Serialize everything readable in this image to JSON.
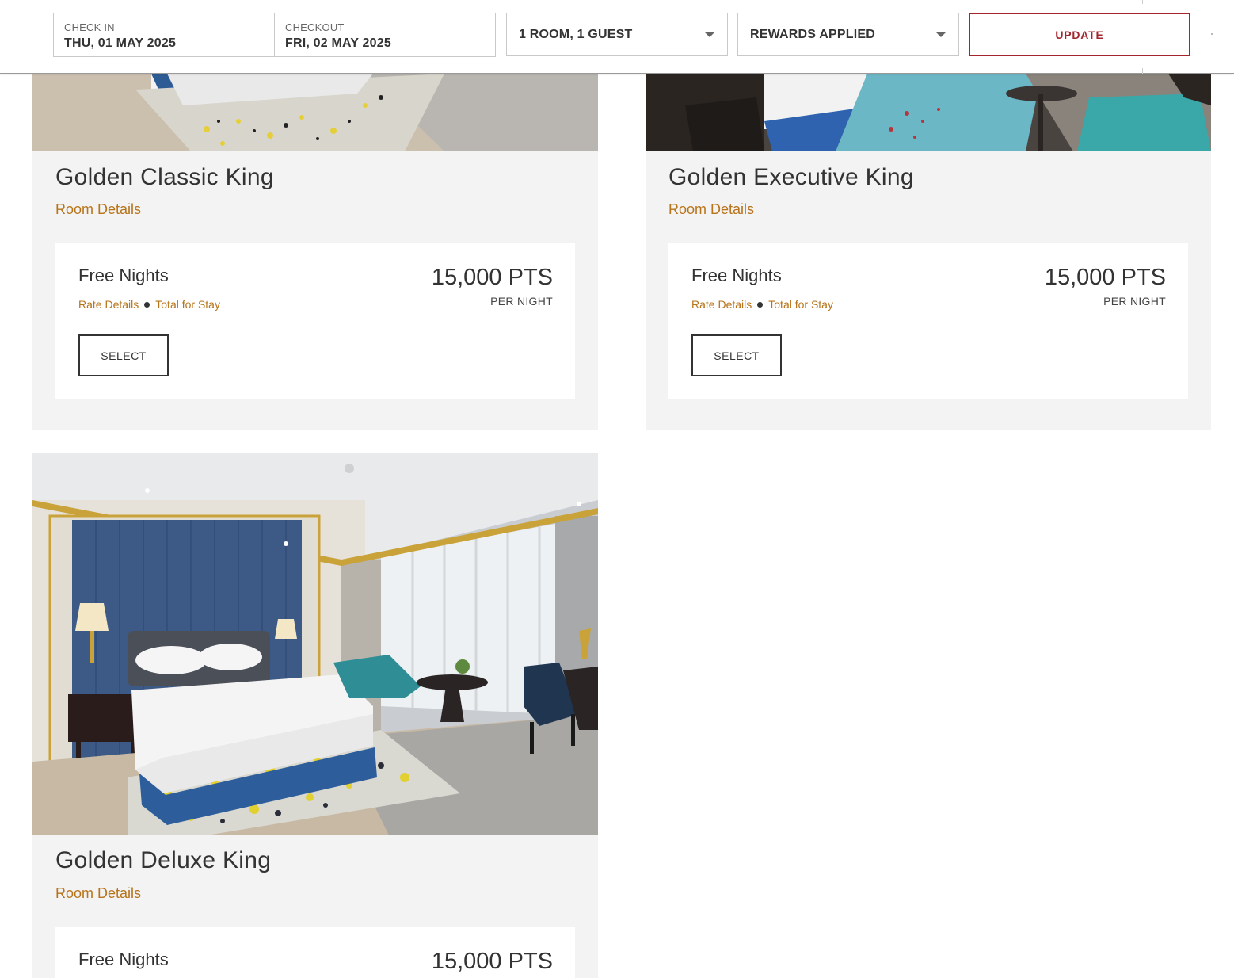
{
  "search": {
    "check_in_label": "CHECK IN",
    "check_in_value": "THU, 01 MAY 2025",
    "checkout_label": "CHECKOUT",
    "checkout_value": "FRI, 02 MAY 2025",
    "guests_value": "1 ROOM, 1 GUEST",
    "rewards_value": "REWARDS APPLIED",
    "update_label": "UPDATE"
  },
  "colors": {
    "accent_gold": "#b8741a",
    "update_red": "#a3262e",
    "card_bg": "#f3f3f3"
  },
  "rooms": [
    {
      "name": "Golden Classic King",
      "details_link": "Room Details",
      "rate": {
        "name": "Free Nights",
        "rate_details": "Rate Details",
        "total_for_stay": "Total for Stay",
        "price": "15,000 PTS",
        "per_night": "PER NIGHT",
        "select_label": "SELECT"
      }
    },
    {
      "name": "Golden Executive King",
      "details_link": "Room Details",
      "rate": {
        "name": "Free Nights",
        "rate_details": "Rate Details",
        "total_for_stay": "Total for Stay",
        "price": "15,000 PTS",
        "per_night": "PER NIGHT",
        "select_label": "SELECT"
      }
    },
    {
      "name": "Golden Deluxe King",
      "details_link": "Room Details",
      "rate": {
        "name": "Free Nights",
        "price": "15,000 PTS"
      }
    }
  ]
}
